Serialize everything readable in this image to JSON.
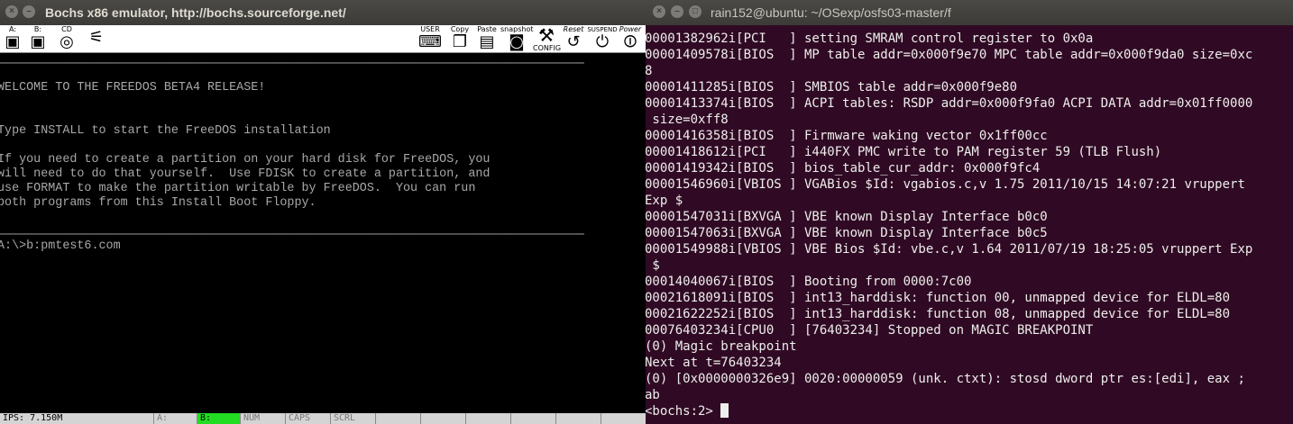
{
  "bochs": {
    "title": "Bochs x86 emulator, http://bochs.sourceforge.net/",
    "toolbar": {
      "floppy_a": "A:",
      "floppy_b": "B:",
      "cdrom": "CD",
      "user": "USER",
      "copy": "Copy",
      "paste": "Paste",
      "snapshot": "snapshot",
      "config": "CONFIG",
      "reset": "Reset",
      "suspend": "SUSPEND",
      "power": "Power"
    },
    "screen_lines": [
      "─────────────────────────────────────────────────────────────────────────────────",
      "",
      "WELCOME TO THE FREEDOS BETA4 RELEASE!",
      "",
      "",
      "Type INSTALL to start the FreeDOS installation",
      "",
      "If you need to create a partition on your hard disk for FreeDOS, you",
      "will need to do that yourself.  Use FDISK to create a partition, and",
      "use FORMAT to make the partition writable by FreeDOS.  You can run",
      "both programs from this Install Boot Floppy.",
      "",
      "",
      "─────────────────────────────────────────────────────────────────────────────────",
      "A:\\>b:pmtest6.com"
    ],
    "status": {
      "ips": "IPS: 7.150M",
      "a": "A:",
      "b": "B:",
      "num": "NUM",
      "caps": "CAPS",
      "scrl": "SCRL"
    }
  },
  "terminal": {
    "title": "rain152@ubuntu: ~/OSexp/osfs03-master/f",
    "lines": [
      "00001382962i[PCI   ] setting SMRAM control register to 0x0a",
      "00001409578i[BIOS  ] MP table addr=0x000f9e70 MPC table addr=0x000f9da0 size=0xc",
      "8",
      "00001411285i[BIOS  ] SMBIOS table addr=0x000f9e80",
      "00001413374i[BIOS  ] ACPI tables: RSDP addr=0x000f9fa0 ACPI DATA addr=0x01ff0000",
      " size=0xff8",
      "00001416358i[BIOS  ] Firmware waking vector 0x1ff00cc",
      "00001418612i[PCI   ] i440FX PMC write to PAM register 59 (TLB Flush)",
      "00001419342i[BIOS  ] bios_table_cur_addr: 0x000f9fc4",
      "00001546960i[VBIOS ] VGABios $Id: vgabios.c,v 1.75 2011/10/15 14:07:21 vruppert",
      "Exp $",
      "00001547031i[BXVGA ] VBE known Display Interface b0c0",
      "00001547063i[BXVGA ] VBE known Display Interface b0c5",
      "00001549988i[VBIOS ] VBE Bios $Id: vbe.c,v 1.64 2011/07/19 18:25:05 vruppert Exp",
      " $",
      "00014040067i[BIOS  ] Booting from 0000:7c00",
      "00021618091i[BIOS  ] int13_harddisk: function 00, unmapped device for ELDL=80",
      "00021622252i[BIOS  ] int13_harddisk: function 08, unmapped device for ELDL=80",
      "00076403234i[CPU0  ] [76403234] Stopped on MAGIC BREAKPOINT",
      "(0) Magic breakpoint",
      "Next at t=76403234",
      "(0) [0x0000000326e9] 0020:00000059 (unk. ctxt): stosd dword ptr es:[edi], eax ;",
      "ab"
    ],
    "prompt": "<bochs:2> "
  }
}
